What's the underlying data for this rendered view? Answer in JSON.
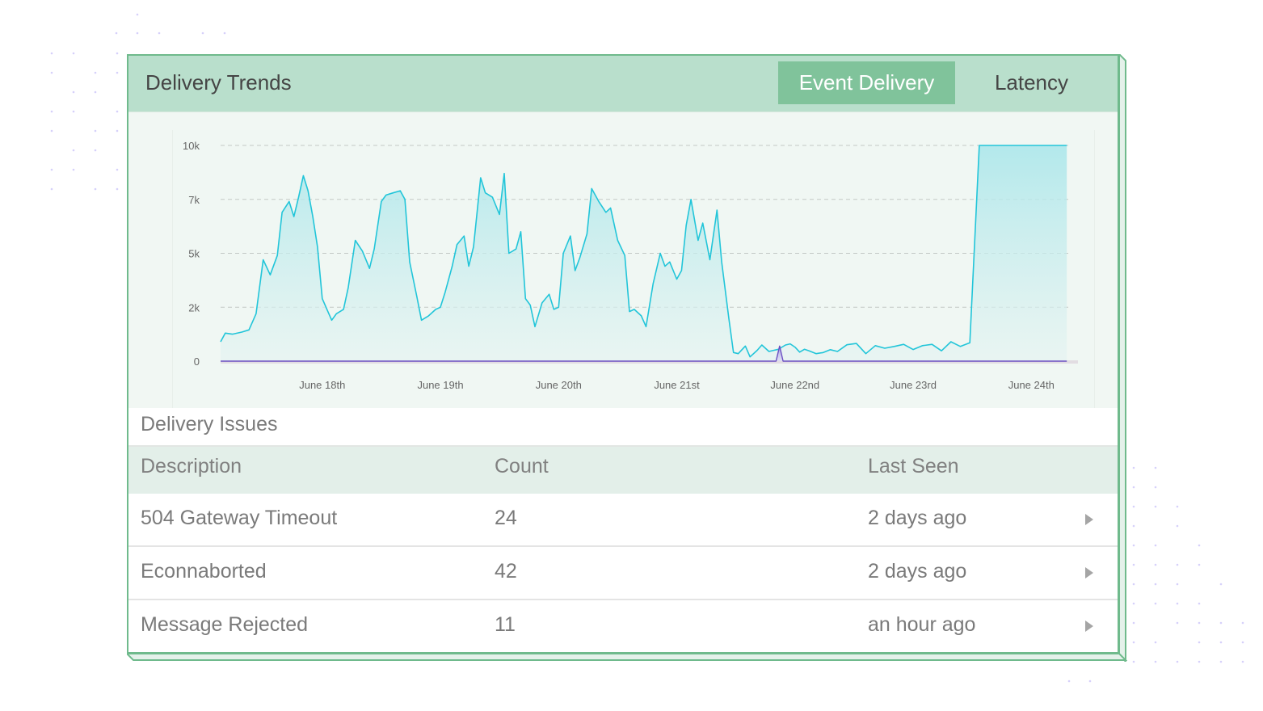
{
  "header": {
    "title": "Delivery Trends",
    "tabs": [
      {
        "label": "Event Delivery",
        "active": true
      },
      {
        "label": "Latency",
        "active": false
      }
    ]
  },
  "colors": {
    "accent": "#80c39b",
    "header_bg": "#b9dfcc",
    "border": "#6fba8c",
    "series_line": "#22c5d9",
    "series_fill": "#a8e6ea",
    "secondary_series": "#6a4fc2",
    "decor_dots": "#d6d0fa"
  },
  "chart_data": {
    "type": "area",
    "title": "",
    "xlabel": "",
    "ylabel": "",
    "y_ticks": [
      "10k",
      "7k",
      "5k",
      "2k",
      "0"
    ],
    "y_tick_values": [
      10000,
      7500,
      5000,
      2500,
      0
    ],
    "ylim": [
      0,
      10000
    ],
    "x_ticks": [
      "June 18th",
      "June 19th",
      "June 20th",
      "June 21st",
      "June 22nd",
      "June 23rd",
      "June 24th"
    ],
    "x_tick_positions_days": [
      0.86,
      1.86,
      2.86,
      3.86,
      4.86,
      5.86,
      6.86
    ],
    "xlim_days": [
      0,
      7.2
    ],
    "grid": true,
    "legend": "none",
    "series": [
      {
        "name": "Event Delivery",
        "x_days": [
          0.0,
          0.04,
          0.1,
          0.18,
          0.24,
          0.3,
          0.36,
          0.42,
          0.48,
          0.52,
          0.58,
          0.62,
          0.66,
          0.7,
          0.74,
          0.78,
          0.82,
          0.86,
          0.9,
          0.94,
          0.98,
          1.04,
          1.08,
          1.14,
          1.2,
          1.26,
          1.3,
          1.36,
          1.4,
          1.46,
          1.52,
          1.56,
          1.6,
          1.66,
          1.7,
          1.76,
          1.82,
          1.86,
          1.9,
          1.96,
          2.0,
          2.06,
          2.1,
          2.14,
          2.2,
          2.24,
          2.3,
          2.36,
          2.4,
          2.44,
          2.5,
          2.54,
          2.58,
          2.62,
          2.66,
          2.72,
          2.78,
          2.82,
          2.86,
          2.9,
          2.96,
          3.0,
          3.04,
          3.1,
          3.14,
          3.2,
          3.26,
          3.3,
          3.36,
          3.42,
          3.46,
          3.5,
          3.56,
          3.6,
          3.66,
          3.72,
          3.76,
          3.8,
          3.86,
          3.9,
          3.94,
          3.98,
          4.04,
          4.08,
          4.14,
          4.2,
          4.24,
          4.3,
          4.34,
          4.38,
          4.44,
          4.48,
          4.54,
          4.58,
          4.64,
          4.68,
          4.72,
          4.78,
          4.82,
          4.86,
          4.9,
          4.94,
          4.98,
          5.04,
          5.1,
          5.16,
          5.22,
          5.3,
          5.38,
          5.46,
          5.54,
          5.62,
          5.7,
          5.78,
          5.86,
          5.94,
          6.02,
          6.1,
          6.18,
          6.26,
          6.34,
          6.42,
          6.5,
          6.58,
          6.66,
          6.74,
          6.82,
          6.9,
          6.98,
          7.06,
          7.12,
          7.16
        ],
        "values": [
          900,
          1300,
          1250,
          1350,
          1450,
          2200,
          4700,
          4000,
          4900,
          6900,
          7400,
          6700,
          7600,
          8600,
          7900,
          6700,
          5300,
          2900,
          2400,
          1900,
          2200,
          2400,
          3400,
          5600,
          5100,
          4300,
          5200,
          7400,
          7700,
          7800,
          7900,
          7500,
          4600,
          3000,
          1900,
          2100,
          2400,
          2500,
          3200,
          4400,
          5400,
          5800,
          4400,
          5300,
          8500,
          7800,
          7600,
          6800,
          8700,
          5000,
          5200,
          6000,
          2900,
          2600,
          1600,
          2700,
          3100,
          2400,
          2500,
          5000,
          5800,
          4200,
          4800,
          5900,
          8000,
          7400,
          6900,
          7100,
          5600,
          4900,
          2300,
          2400,
          2100,
          1600,
          3600,
          5000,
          4400,
          4600,
          3800,
          4200,
          6300,
          7500,
          5600,
          6400,
          4700,
          7000,
          4600,
          2000,
          400,
          350,
          700,
          200,
          500,
          750,
          450,
          500,
          550,
          750,
          800,
          650,
          420,
          550,
          480,
          350,
          400,
          530,
          450,
          760,
          820,
          350,
          720,
          600,
          680,
          780,
          540,
          720,
          780,
          480,
          900,
          680,
          850
        ],
        "color": "#22c5d9"
      },
      {
        "name": "Secondary (spike)",
        "x_days": [
          0.0,
          4.64,
          4.7,
          4.73,
          4.76,
          4.82,
          7.16
        ],
        "values": [
          0,
          0,
          0,
          700,
          0,
          0,
          0
        ],
        "color": "#6a4fc2"
      }
    ]
  },
  "issues": {
    "title": "Delivery Issues",
    "columns": [
      "Description",
      "Count",
      "Last Seen"
    ],
    "rows": [
      {
        "description": "504 Gateway Timeout",
        "count": "24",
        "last_seen": "2 days ago"
      },
      {
        "description": "Econnaborted",
        "count": "42",
        "last_seen": "2 days ago"
      },
      {
        "description": "Message Rejected",
        "count": "11",
        "last_seen": "an hour ago"
      }
    ]
  }
}
